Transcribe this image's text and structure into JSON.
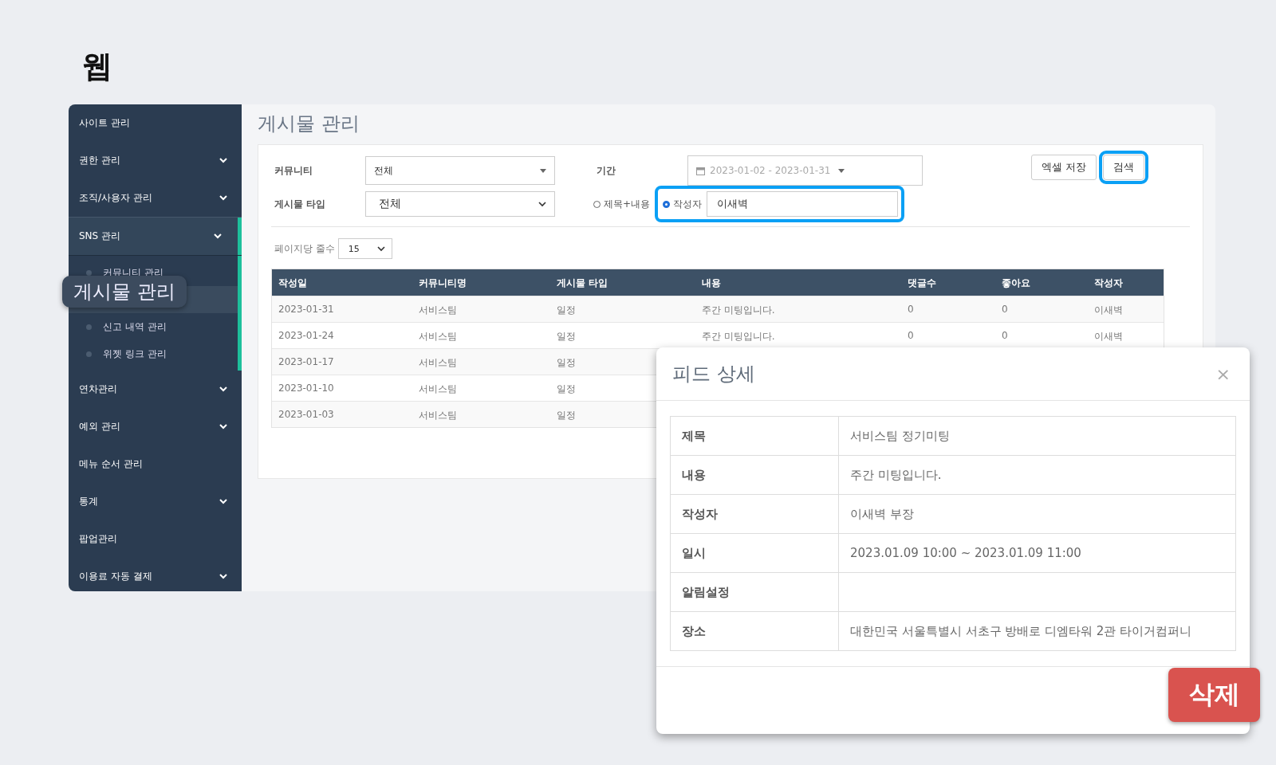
{
  "page_title": "웹",
  "sidebar": {
    "items": [
      {
        "label": "사이트 관리",
        "caret": false,
        "expanded": false
      },
      {
        "label": "권한 관리",
        "caret": true,
        "expanded": false
      },
      {
        "label": "조직/사용자 관리",
        "caret": true,
        "expanded": false
      },
      {
        "label": "SNS 관리",
        "caret": true,
        "expanded": true,
        "children": [
          {
            "label": "커뮤니티 관리",
            "selected": false
          },
          {
            "selected": true
          },
          {
            "label": "신고 내역 관리",
            "selected": false
          },
          {
            "label": "위젯 링크 관리",
            "selected": false
          }
        ]
      },
      {
        "label": "연차관리",
        "caret": true,
        "expanded": false
      },
      {
        "label": "예외 관리",
        "caret": true,
        "expanded": false
      },
      {
        "label": "메뉴 순서 관리",
        "caret": false,
        "expanded": false
      },
      {
        "label": "통계",
        "caret": true,
        "expanded": false
      },
      {
        "label": "팝업관리",
        "caret": false,
        "expanded": false
      },
      {
        "label": "이용료 자동 결제",
        "caret": true,
        "expanded": false
      }
    ]
  },
  "callout": "게시물 관리",
  "main_title": "게시물 관리",
  "filters": {
    "community": {
      "label": "커뮤니티",
      "value": "전체"
    },
    "post_type": {
      "label": "게시물 타입",
      "value": "전체"
    },
    "period": {
      "label": "기간",
      "value": "2023-01-02 - 2023-01-31"
    },
    "search_mode": [
      {
        "label": "제목+내용",
        "selected": false
      },
      {
        "label": "작성자",
        "selected": true
      }
    ],
    "author": {
      "value": "이새벽",
      "highlighted": true
    },
    "buttons": [
      {
        "label": "엑셀 저장",
        "highlighted": false
      },
      {
        "label": "검색",
        "highlighted": true
      }
    ]
  },
  "page_size": {
    "label": "페이지당 줄수",
    "value": "15"
  },
  "table": {
    "columns": [
      "작성일",
      "커뮤니티명",
      "게시물 타입",
      "내용",
      "댓글수",
      "좋아요",
      "작성자"
    ],
    "rows": [
      [
        "2023-01-31",
        "서비스팀",
        "일정",
        "주간 미팅입니다.",
        "0",
        "0",
        "이새벽"
      ],
      [
        "2023-01-24",
        "서비스팀",
        "일정",
        "주간 미팅입니다.",
        "0",
        "0",
        "이새벽"
      ],
      [
        "2023-01-17",
        "서비스팀",
        "일정"
      ],
      [
        "2023-01-10",
        "서비스팀",
        "일정"
      ],
      [
        "2023-01-03",
        "서비스팀",
        "일정"
      ]
    ]
  },
  "modal": {
    "title": "피드 상세",
    "close": "×",
    "rows": [
      {
        "label": "제목",
        "value": "서비스팀 정기미팅"
      },
      {
        "label": "내용",
        "value": "주간 미팅입니다."
      },
      {
        "label": "작성자",
        "value": "이새벽 부장"
      },
      {
        "label": "일시",
        "value": "2023.01.09 10:00 ~ 2023.01.09 11:00"
      },
      {
        "label": "알림설정",
        "value": ""
      },
      {
        "label": "장소",
        "value": "대한민국 서울특별시 서초구 방배로 디엠타워 2관 타이거컴퍼니"
      }
    ],
    "delete": "삭제"
  }
}
